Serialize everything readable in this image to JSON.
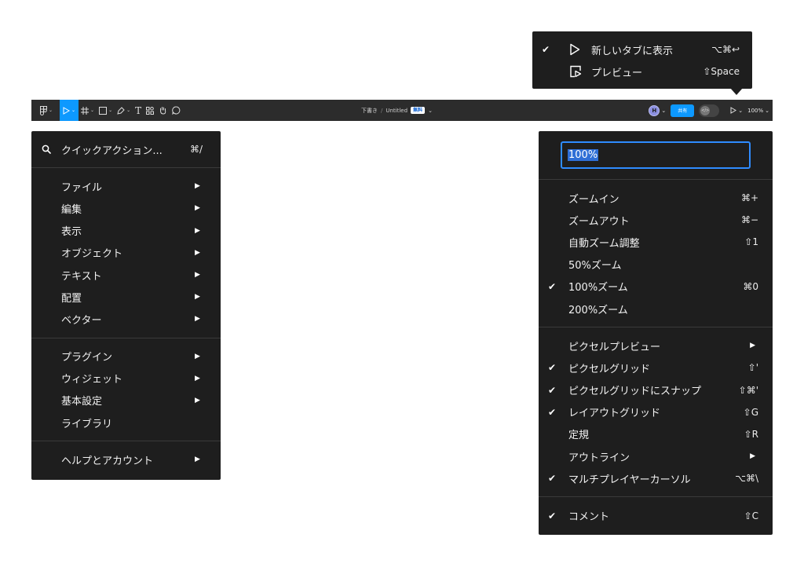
{
  "toolbar": {
    "caret": "⌄",
    "text_tool": "T",
    "breadcrumb": {
      "location": "下書き",
      "separator": "/",
      "file_name": "Untitled",
      "badge": "無料"
    },
    "avatar_initial": "H",
    "share_label": "共有",
    "dev_mode_icon": "</>",
    "zoom_level": "100%"
  },
  "main_menu": {
    "search": {
      "label": "クイックアクション...",
      "shortcut": "⌘/"
    },
    "groups": [
      [
        {
          "label": "ファイル",
          "arrow": "▶"
        },
        {
          "label": "編集",
          "arrow": "▶"
        },
        {
          "label": "表示",
          "arrow": "▶"
        },
        {
          "label": "オブジェクト",
          "arrow": "▶"
        },
        {
          "label": "テキスト",
          "arrow": "▶"
        },
        {
          "label": "配置",
          "arrow": "▶"
        },
        {
          "label": "ベクター",
          "arrow": "▶"
        }
      ],
      [
        {
          "label": "プラグイン",
          "arrow": "▶"
        },
        {
          "label": "ウィジェット",
          "arrow": "▶"
        },
        {
          "label": "基本設定",
          "arrow": "▶"
        },
        {
          "label": "ライブラリ",
          "arrow": ""
        }
      ],
      [
        {
          "label": "ヘルプとアカウント",
          "arrow": "▶"
        }
      ]
    ]
  },
  "zoom_menu": {
    "input_value": "100%",
    "groups": [
      [
        {
          "label": "ズームイン",
          "shortcut": "⌘+",
          "check": ""
        },
        {
          "label": "ズームアウト",
          "shortcut": "⌘−",
          "check": ""
        },
        {
          "label": "自動ズーム調整",
          "shortcut": "⇧1",
          "check": ""
        },
        {
          "label": "50%ズーム",
          "shortcut": "",
          "check": ""
        },
        {
          "label": "100%ズーム",
          "shortcut": "⌘0",
          "check": "✔"
        },
        {
          "label": "200%ズーム",
          "shortcut": "",
          "check": ""
        }
      ],
      [
        {
          "label": "ピクセルプレビュー",
          "shortcut": "",
          "arrow": "▶",
          "check": ""
        },
        {
          "label": "ピクセルグリッド",
          "shortcut": "⇧'",
          "check": "✔"
        },
        {
          "label": "ピクセルグリッドにスナップ",
          "shortcut": "⇧⌘'",
          "check": "✔"
        },
        {
          "label": "レイアウトグリッド",
          "shortcut": "⇧G",
          "check": "✔"
        },
        {
          "label": "定規",
          "shortcut": "⇧R",
          "check": ""
        },
        {
          "label": "アウトライン",
          "shortcut": "",
          "arrow": "▶",
          "check": ""
        },
        {
          "label": "マルチプレイヤーカーソル",
          "shortcut": "⌥⌘\\",
          "check": "✔"
        }
      ],
      [
        {
          "label": "コメント",
          "shortcut": "⇧C",
          "check": "✔"
        }
      ]
    ]
  },
  "preview_menu": {
    "items": [
      {
        "label": "新しいタブに表示",
        "shortcut": "⌥⌘↩",
        "check": "✔",
        "icon": "play-icon"
      },
      {
        "label": "プレビュー",
        "shortcut": "⇧Space",
        "check": "",
        "icon": "preview-icon"
      }
    ]
  },
  "colors": {
    "toolbar": "#2c2c2c",
    "menu": "#1e1e1e",
    "accent": "#0d99ff",
    "selection": "#2f6fd6"
  }
}
